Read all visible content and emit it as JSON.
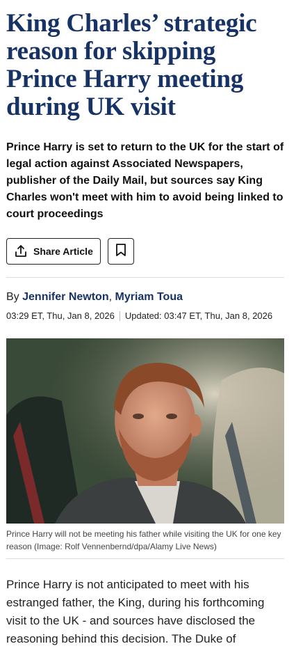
{
  "article": {
    "headline": "King Charles’ strategic reason for skipping Prince Harry meeting during UK visit",
    "standfirst": "Prince Harry is set to return to the UK for the start of legal action against Associated Newspapers, publisher of the Daily Mail, but sources say King Charles won't meet with him to avoid being linked to court proceedings",
    "actions": {
      "share_label": "Share Article",
      "share_icon": "share-icon",
      "bookmark_icon": "bookmark-icon"
    },
    "byline": {
      "prefix": "By",
      "authors": [
        "Jennifer Newton",
        "Myriam Toua"
      ],
      "separator": ","
    },
    "published": "03:29 ET, Thu, Jan 8, 2026",
    "updated": "Updated: 03:47 ET, Thu, Jan 8, 2026",
    "image": {
      "caption": "Prince Harry will not be meeting his father while visiting the UK for one key reason",
      "credit": "(Image: Rolf Vennenbernd/dpa/Alamy Live News)"
    },
    "body": "Prince Harry is not anticipated to meet with his estranged father, the King, during his forthcoming visit to the UK - and sources have disclosed the reasoning behind this decision. The Duke of"
  },
  "colors": {
    "headline": "#173366",
    "author_link": "#173366",
    "text": "#222222",
    "divider": "#dddddd"
  }
}
